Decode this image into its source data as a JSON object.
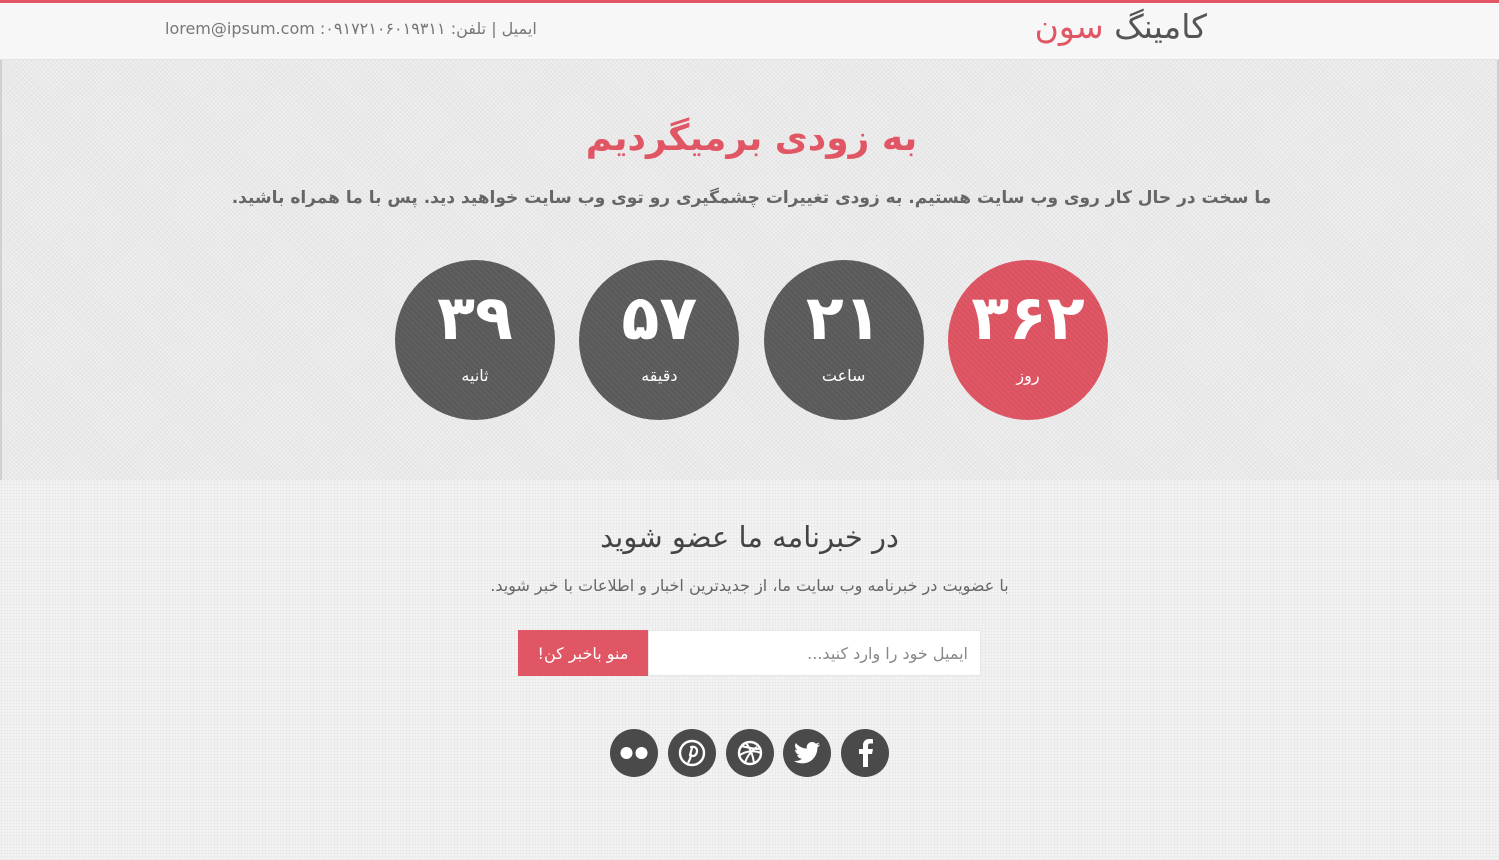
{
  "header": {
    "brand_main": "کامینگ",
    "brand_accent": "سون",
    "contact": "lorem@ipsum.com :تلفن: ۰۹۱۷۲۱۰۶۰۱۹۳۱۱ | ایمیل"
  },
  "hero": {
    "title": "به زودی برمیگردیم",
    "text": "ما سخت در حال کار روی وب سایت هستیم. به زودی تغییرات چشمگیری رو توی وب سایت خواهید دید. پس با ما همراه باشید."
  },
  "countdown": [
    {
      "value": "۳۶۲",
      "label": "روز",
      "active": true
    },
    {
      "value": "۲۱",
      "label": "ساعت",
      "active": false
    },
    {
      "value": "۵۷",
      "label": "دقیقه",
      "active": false
    },
    {
      "value": "۳۹",
      "label": "ثانیه",
      "active": false
    }
  ],
  "newsletter": {
    "title": "در خبرنامه ما عضو شوید",
    "text": "با عضویت در خبرنامه وب سایت ما، از جدیدترین اخبار و اطلاعات با خبر شوید.",
    "placeholder": "ایمیل خود را وارد کنید...",
    "button_label": "منو باخبر کن!"
  },
  "social": [
    {
      "icon": "facebook-icon"
    },
    {
      "icon": "twitter-icon"
    },
    {
      "icon": "dribbble-icon"
    },
    {
      "icon": "pinterest-icon"
    },
    {
      "icon": "flickr-icon"
    }
  ],
  "colors": {
    "accent": "#e15664",
    "circle": "#5a5a5a",
    "social": "#4a4a4a"
  }
}
